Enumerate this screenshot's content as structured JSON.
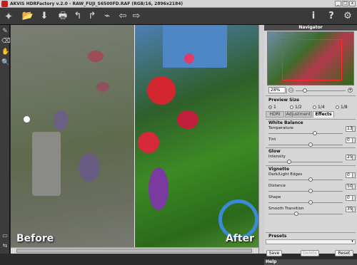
{
  "window": {
    "title": "AKVIS HDRFactory v.2.0 - RAW_FUJI_S6500FD.RAF (RGB/16, 2896x2184)",
    "minimize_label": "_",
    "maximize_label": "□",
    "close_label": "x"
  },
  "toolbar": {
    "left_icons": [
      "open-icon",
      "save-icon",
      "print-icon",
      "undo-icon",
      "redo-icon",
      "brush-icon",
      "back-icon",
      "forward-icon"
    ],
    "right_icons": [
      "info-icon",
      "help-icon",
      "settings-icon"
    ]
  },
  "canvas": {
    "before_label": "Before",
    "after_label": "After"
  },
  "navigator": {
    "title": "Navigator",
    "zoom_value": "28%"
  },
  "preview_size": {
    "title": "Preview Size",
    "options": [
      "1",
      "1/2",
      "1/4",
      "1/8"
    ],
    "selected_index": 0
  },
  "tabs": [
    {
      "label": "HDRI",
      "active": false
    },
    {
      "label": "Adjustment",
      "active": false
    },
    {
      "label": "Effects",
      "active": true
    }
  ],
  "effects": {
    "white_balance": {
      "title": "White Balance",
      "temperature": {
        "label": "Temperature",
        "value": "13"
      },
      "tint": {
        "label": "Tint",
        "value": "0"
      }
    },
    "glow": {
      "title": "Glow",
      "intensity": {
        "label": "Intensity",
        "value": "25"
      }
    },
    "vignette": {
      "title": "Vignette",
      "dark_light_edges": {
        "label": "Dark/Light Edges",
        "value": "0"
      },
      "distance": {
        "label": "Distance",
        "value": "50"
      },
      "shape": {
        "label": "Shape",
        "value": "0"
      },
      "smooth_transition": {
        "label": "Smooth Transition",
        "value": "35"
      }
    }
  },
  "presets": {
    "title": "Presets",
    "save_label": "Save",
    "delete_label": "Delete",
    "reset_label": "Reset"
  },
  "help": {
    "title": "Help"
  }
}
